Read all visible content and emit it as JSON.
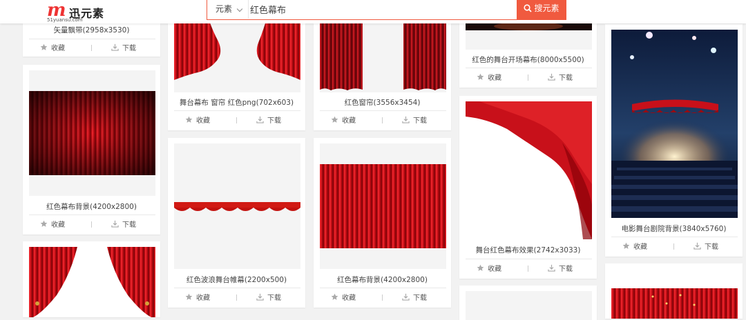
{
  "header": {
    "logo_mark": "m",
    "logo_cn": "迅元素",
    "logo_en": "51yuansu.com",
    "search_type": "元素",
    "search_value": "红色幕布",
    "search_button": "搜元素"
  },
  "actions": {
    "collect": "收藏",
    "download": "下载"
  },
  "cards": [
    {
      "title": "矢量飘带(2958x3530)"
    },
    {
      "title": "红色幕布背景(4200x2800)"
    },
    {
      "title": ""
    },
    {
      "title": "舞台幕布 窗帘 红色png(702x603)"
    },
    {
      "title": "红色波浪舞台帷幕(2200x500)"
    },
    {
      "title": "红色窗帘(3556x3454)"
    },
    {
      "title": "红色幕布背景(4200x2800)"
    },
    {
      "title": "红色的舞台开场幕布(8000x5500)"
    },
    {
      "title": "舞台红色幕布效果(2742x3033)"
    },
    {
      "title": ""
    },
    {
      "title": "电影舞台剧院背景(3840x5760)"
    },
    {
      "title": ""
    }
  ],
  "colors": {
    "accent": "#f05a3f",
    "curtain": "#c8101a"
  }
}
